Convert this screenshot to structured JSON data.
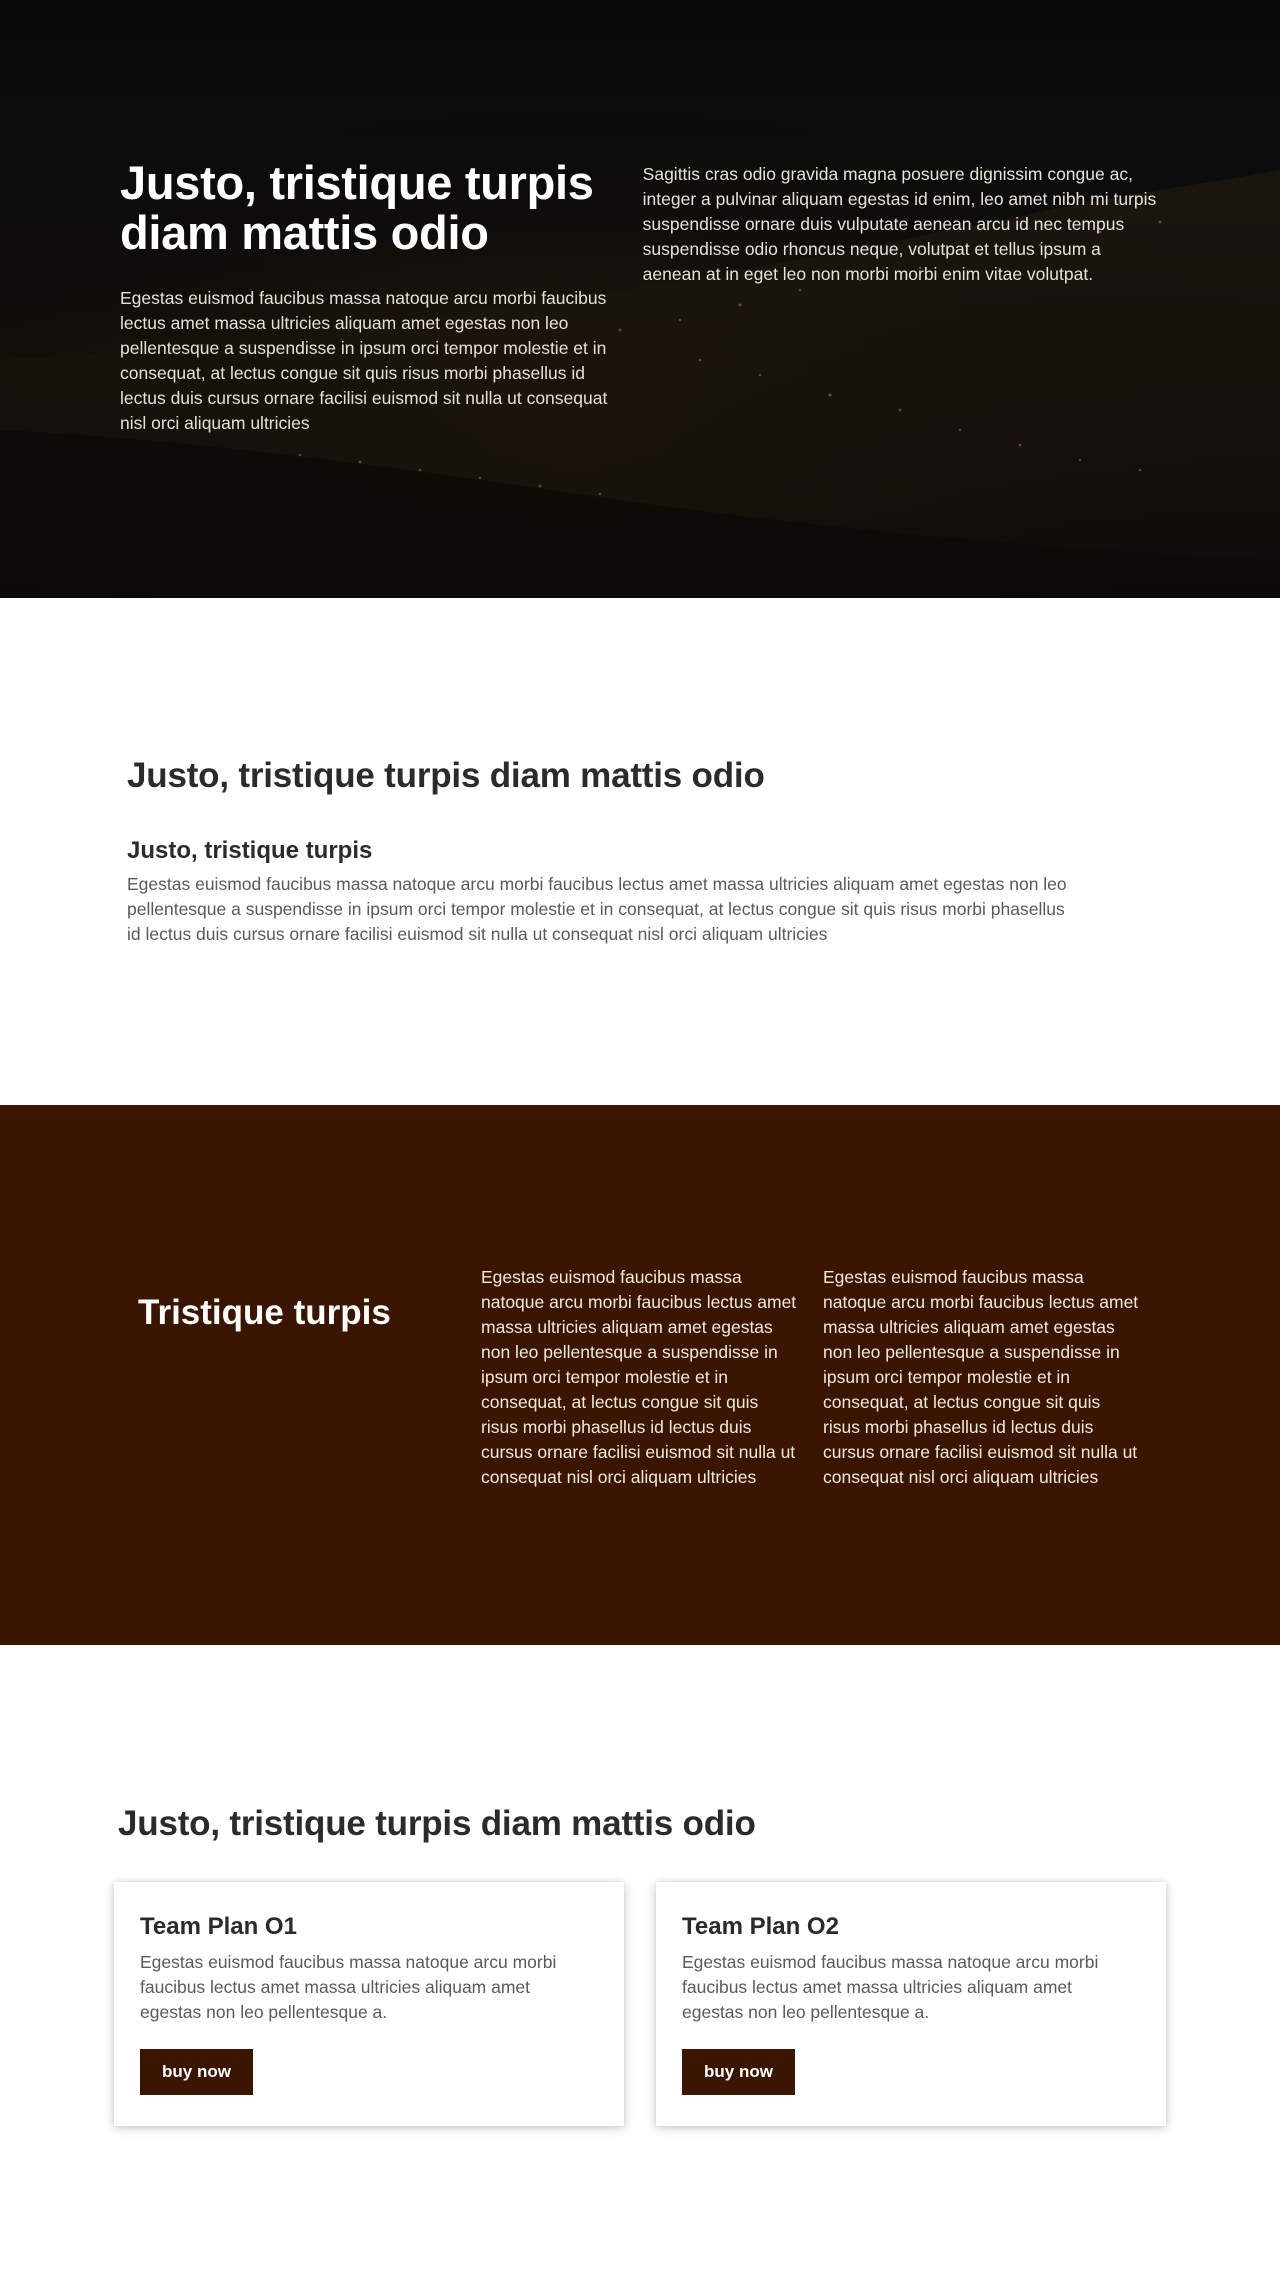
{
  "hero": {
    "title": "Justo, tristique turpis diam mattis odio",
    "text_left": "Egestas euismod faucibus massa natoque arcu morbi faucibus lectus amet massa ultricies aliquam amet egestas non leo pellentesque a suspendisse in ipsum orci tempor molestie et in consequat, at lectus congue sit quis risus morbi phasellus id lectus duis cursus ornare facilisi euismod sit nulla ut consequat nisl orci aliquam ultricies",
    "text_right": "Sagittis cras odio gravida magna posuere dignissim congue ac, integer a pulvinar aliquam egestas id enim, leo amet nibh mi turpis suspendisse ornare duis vulputate aenean arcu id nec tempus suspendisse odio rhoncus neque, volutpat et tellus ipsum a aenean at in eget leo non morbi morbi enim vitae volutpat."
  },
  "features": {
    "title": "Justo, tristique turpis diam mattis odio",
    "subtitle": "Justo, tristique turpis",
    "text": "Egestas euismod faucibus massa natoque arcu morbi faucibus lectus amet massa ultricies aliquam amet egestas non leo pellentesque a suspendisse in ipsum orci tempor molestie et in consequat, at lectus congue sit quis risus morbi phasellus id lectus duis cursus ornare facilisi euismod sit nulla ut consequat nisl orci aliquam ultricies"
  },
  "brown": {
    "title": "Tristique turpis",
    "col1": "Egestas euismod faucibus massa natoque arcu morbi faucibus lectus amet massa ultricies aliquam amet egestas non leo pellentesque a suspendisse in ipsum orci tempor molestie et in consequat, at lectus congue sit quis risus morbi phasellus id lectus duis cursus ornare facilisi euismod sit nulla ut consequat nisl orci aliquam ultricies",
    "col2": "Egestas euismod faucibus massa natoque arcu morbi faucibus lectus amet massa ultricies aliquam amet egestas non leo pellentesque a suspendisse in ipsum orci tempor molestie et in consequat, at lectus congue sit quis risus morbi phasellus id lectus duis cursus ornare facilisi euismod sit nulla ut consequat nisl orci aliquam ultricies"
  },
  "pricing": {
    "title": "Justo, tristique turpis diam mattis odio",
    "plans": [
      {
        "name": "Team Plan O1",
        "text": "Egestas euismod faucibus massa natoque arcu morbi faucibus lectus amet massa ultricies aliquam amet egestas non leo pellentesque a.",
        "button": "buy now"
      },
      {
        "name": "Team Plan O2",
        "text": "Egestas euismod faucibus massa natoque arcu morbi faucibus lectus amet massa ultricies aliquam amet egestas non leo pellentesque a.",
        "button": "buy now"
      }
    ]
  },
  "colors": {
    "brand_brown": "#3a1602",
    "heading_dark": "#2b2b2b",
    "hero_dark": "#0e0e0e"
  }
}
